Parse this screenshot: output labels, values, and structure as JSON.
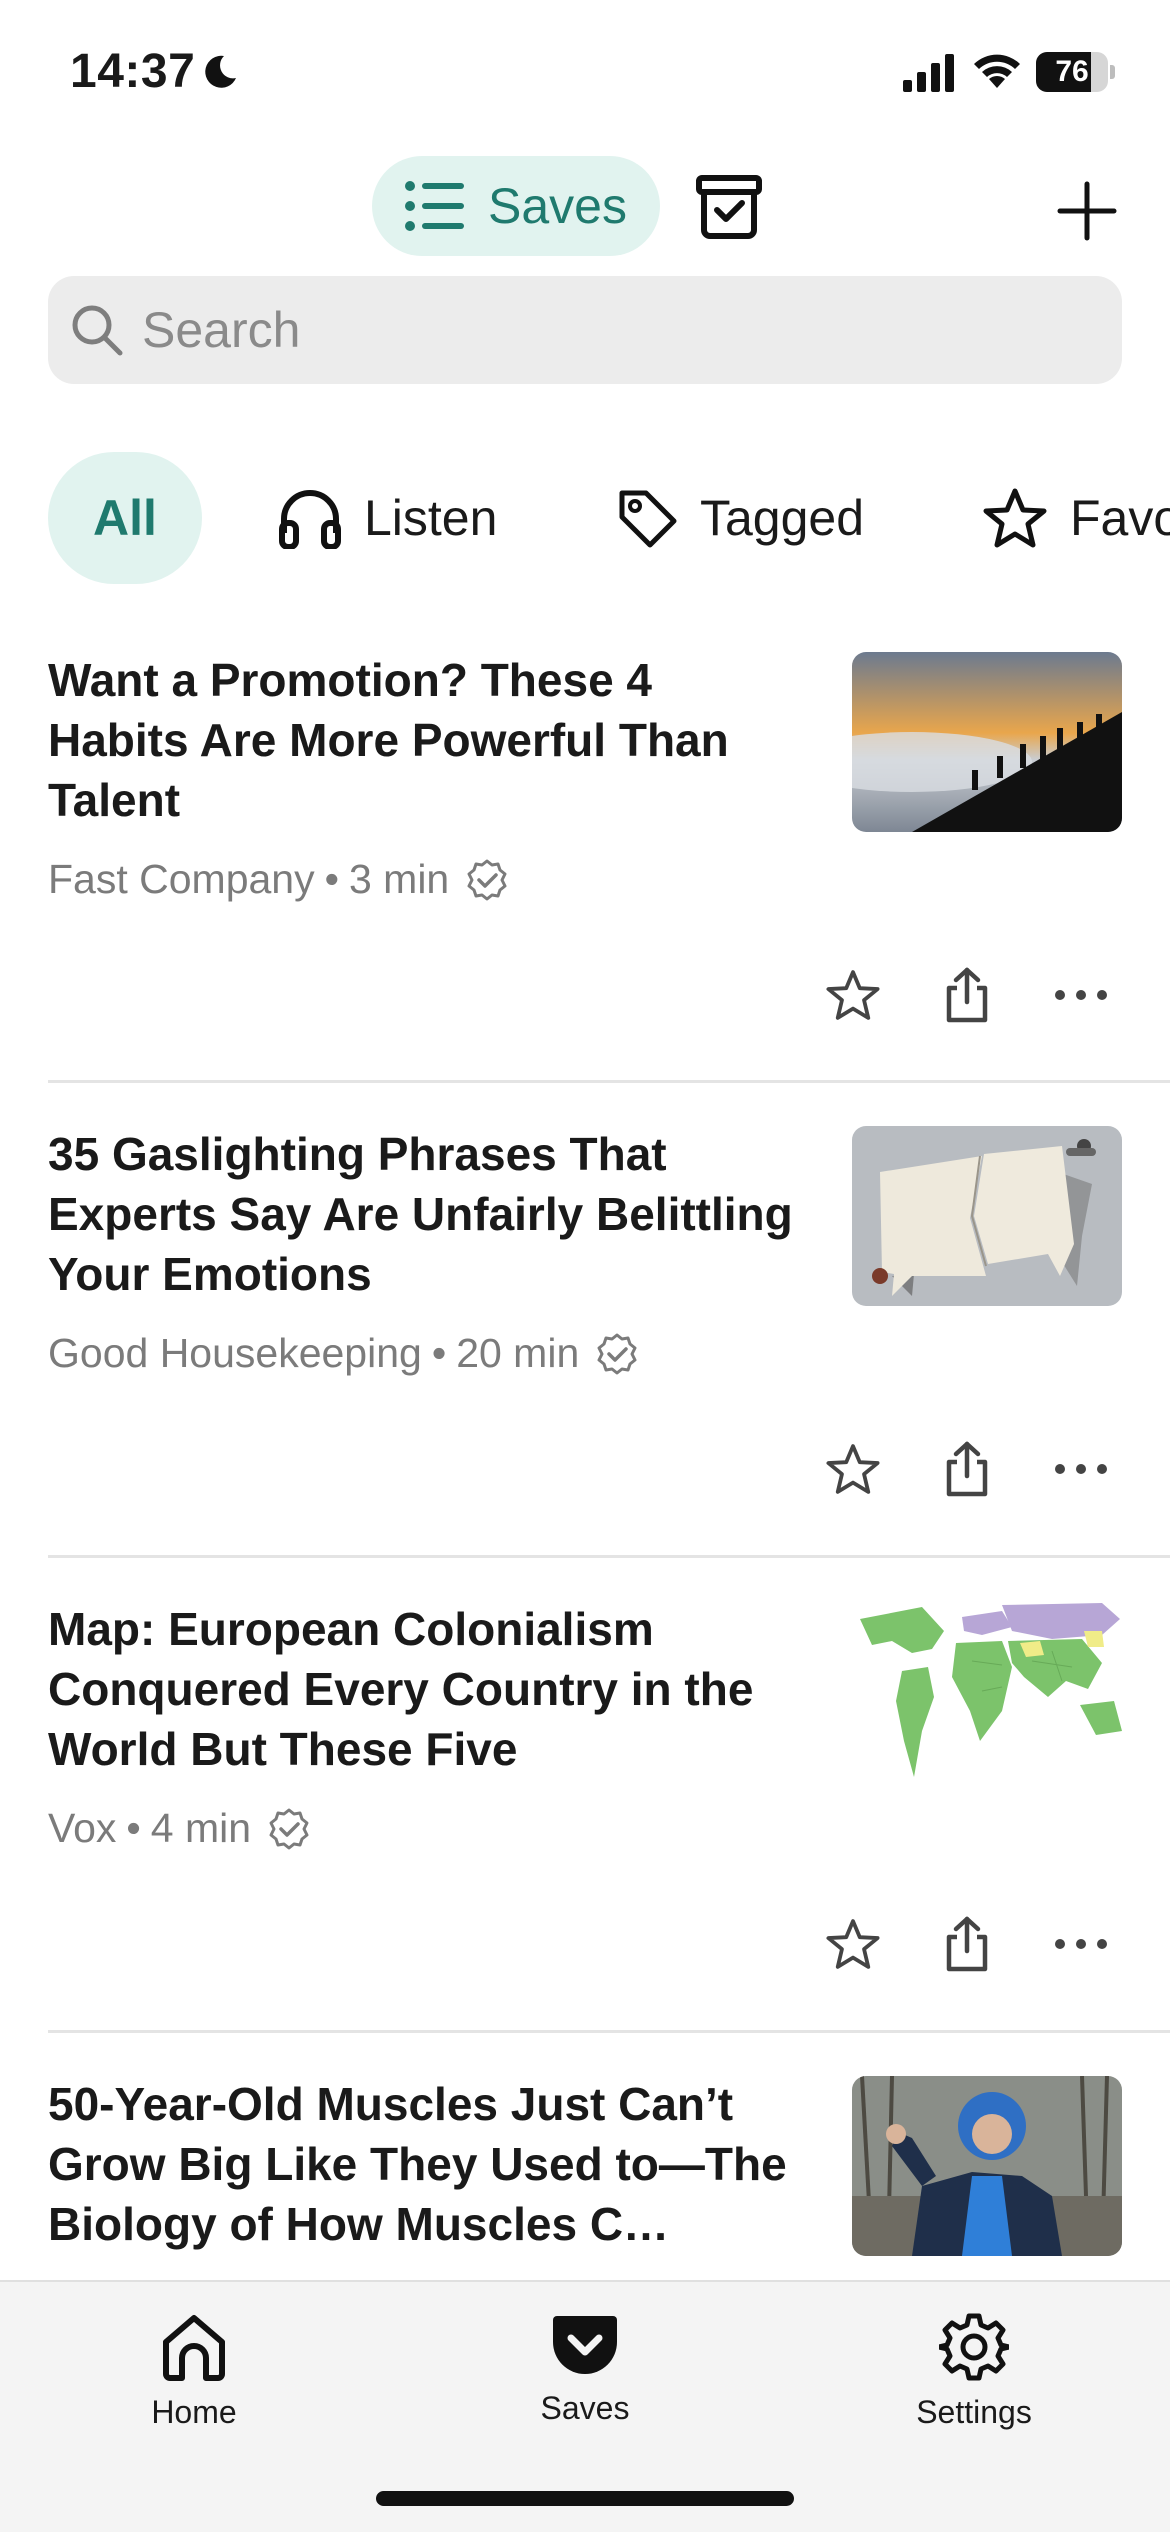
{
  "status": {
    "time": "14:37",
    "battery": "76",
    "battery_level_pct": 76
  },
  "nav": {
    "active_tab_label": "Saves",
    "archive_icon": "archive-icon",
    "add_icon": "plus-icon"
  },
  "search": {
    "placeholder": "Search"
  },
  "filters": [
    {
      "label": "All",
      "icon": ""
    },
    {
      "label": "Listen",
      "icon": "headphones-icon"
    },
    {
      "label": "Tagged",
      "icon": "tag-icon"
    },
    {
      "label": "Favorites",
      "icon": "star-icon"
    }
  ],
  "articles": [
    {
      "title": "Want a Promotion? These 4 Habits Are More Powerful Than Talent",
      "source": "Fast Company",
      "read_time": "3 min",
      "thumbnail": "hikers silhouetted at sunset above clouds"
    },
    {
      "title": "35 Gaslighting Phrases That Experts Say Are Unfairly Belittling Your Emotions",
      "source": "Good Housekeeping",
      "read_time": "20 min",
      "thumbnail": "torn speech bubble with figures"
    },
    {
      "title": "Map: European Colonialism Conquered Every Country in the World But These Five",
      "source": "Vox",
      "read_time": "4 min",
      "thumbnail": "colored world map"
    },
    {
      "title": "50-Year-Old Muscles Just Can’t Grow Big Like They Used to—The Biology of How Muscles C…",
      "source": "",
      "read_time": "",
      "thumbnail": "older man flexing bicep"
    }
  ],
  "tabbar": {
    "home": "Home",
    "saves": "Saves",
    "settings": "Settings"
  },
  "colors": {
    "accent": "#1f7a6e",
    "accent_bg": "#e1f3ef"
  }
}
